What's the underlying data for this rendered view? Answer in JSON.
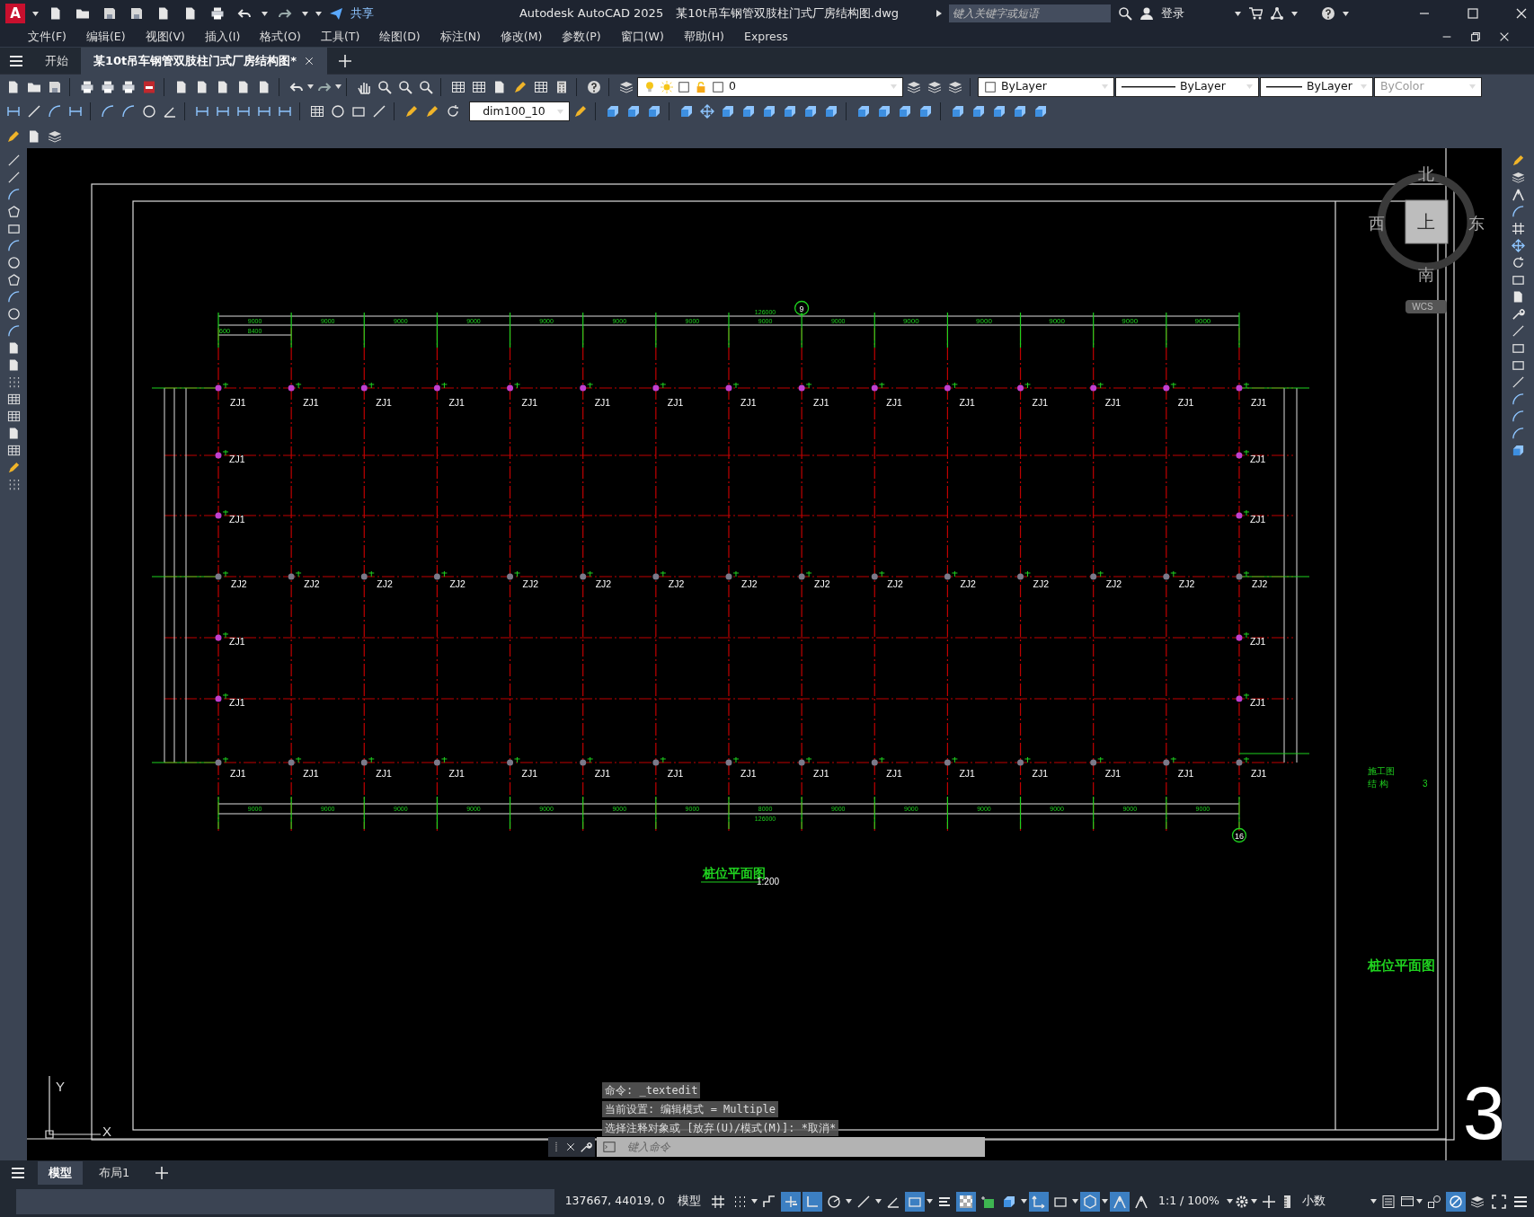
{
  "title_bar": {
    "logo": "A",
    "share": "共享",
    "app_title": "Autodesk AutoCAD 2025",
    "file_title": "某10t吊车钢管双肢柱门式厂房结构图.dwg",
    "search": {
      "placeholder": "键入关键字或短语"
    },
    "login": "登录"
  },
  "menu": [
    "文件(F)",
    "编辑(E)",
    "视图(V)",
    "插入(I)",
    "格式(O)",
    "工具(T)",
    "绘图(D)",
    "标注(N)",
    "修改(M)",
    "参数(P)",
    "窗口(W)",
    "帮助(H)",
    "Express"
  ],
  "doc_tabs": [
    {
      "label": "开始",
      "selected": false
    },
    {
      "label": "某10t吊车钢管双肢柱门式厂房结构图*",
      "selected": true
    }
  ],
  "properties": {
    "layer": "0",
    "colour_control": "ByLayer",
    "linetype": "ByLayer",
    "lineweight": "ByLayer",
    "plot_style": {
      "value": "ByColor",
      "disabled": true
    },
    "dim_style": "dim100_10"
  },
  "viewcube": {
    "north": "北",
    "south": "南",
    "west": "西",
    "east": "东",
    "face": "上",
    "wcs": "WCS"
  },
  "drawing": {
    "top_axis": "9",
    "bottom_axis": "16",
    "top_total": "126000",
    "top_sub": [
      "600",
      "8400"
    ],
    "top_spans": [
      "9000",
      "9000",
      "9000",
      "9000",
      "9000",
      "9000",
      "9000",
      "9000",
      "9000",
      "9000",
      "9000",
      "9000",
      "9000",
      "9000"
    ],
    "bottom_spans": [
      "9000",
      "9000",
      "9000",
      "9000",
      "9000",
      "9000",
      "9000",
      "8000",
      "9000",
      "9000",
      "9000",
      "9000",
      "9000",
      "9000"
    ],
    "bottom_total": "126000",
    "rows": [
      {
        "kind": "full",
        "color": "#c040d0",
        "labels": [
          "ZJ1",
          "ZJ1",
          "ZJ1",
          "ZJ1",
          "ZJ1",
          "ZJ1",
          "ZJ1",
          "ZJ1",
          "ZJ1",
          "ZJ1",
          "ZJ1",
          "ZJ1",
          "ZJ1",
          "ZJ1",
          "ZJ1"
        ]
      },
      {
        "kind": "ends",
        "color": "#c040d0",
        "labels": [
          "ZJ1",
          "ZJ1"
        ]
      },
      {
        "kind": "ends",
        "color": "#c040d0",
        "labels": [
          "ZJ1",
          "ZJ1"
        ]
      },
      {
        "kind": "full",
        "color": "#7a7a8a",
        "labels": [
          "ZJ2",
          "ZJ2",
          "ZJ2",
          "ZJ2",
          "ZJ2",
          "ZJ2",
          "ZJ2",
          "ZJ2",
          "ZJ2",
          "ZJ2",
          "ZJ2",
          "ZJ2",
          "ZJ2",
          "ZJ2",
          "ZJ2"
        ]
      },
      {
        "kind": "ends",
        "color": "#c040d0",
        "labels": [
          "ZJ1",
          "ZJ1"
        ]
      },
      {
        "kind": "ends",
        "color": "#c040d0",
        "labels": [
          "ZJ1",
          "ZJ1"
        ]
      },
      {
        "kind": "full",
        "color": "#7a7a8a",
        "labels": [
          "ZJ1",
          "ZJ1",
          "ZJ1",
          "ZJ1",
          "ZJ1",
          "ZJ1",
          "ZJ1",
          "ZJ1",
          "ZJ1",
          "ZJ1",
          "ZJ1",
          "ZJ1",
          "ZJ1",
          "ZJ1",
          "ZJ1"
        ]
      }
    ],
    "title": "桩位平面图",
    "scale": "1:200"
  },
  "title_block": {
    "stage": "施工图",
    "discipline": "结 构",
    "number": "3",
    "drawing_name": "桩位平面图",
    "sheet": "3"
  },
  "ucs": {
    "y": "Y",
    "x": "X"
  },
  "command_history": [
    "命令: _textedit",
    "当前设置: 编辑模式 = Multiple",
    "选择注释对象或 [放弃(U)/模式(M)]: *取消*"
  ],
  "command": {
    "placeholder": "键入命令"
  },
  "layout_tabs": [
    {
      "label": "模型",
      "selected": true
    },
    {
      "label": "布局1",
      "selected": false
    }
  ],
  "status_bar": {
    "coords": "137667, 44019, 0",
    "space": "模型",
    "annotation_scale": "1:1 / 100%",
    "units": "小数",
    "toggles": [
      {
        "kind": "grid",
        "on": false
      },
      {
        "kind": "dots",
        "on": false
      },
      {
        "kind": "snap",
        "on": false
      },
      {
        "kind": "infer",
        "on": true
      },
      {
        "kind": "ortho",
        "on": true
      },
      {
        "kind": "polar",
        "on": false
      },
      {
        "kind": "iso",
        "on": false
      },
      {
        "kind": "angle",
        "on": false
      },
      {
        "kind": "osnap",
        "on": true
      },
      {
        "kind": "lineweight",
        "on": false
      },
      {
        "kind": "transparency",
        "on": true
      },
      {
        "kind": "select",
        "on": false
      },
      {
        "kind": "gizmo",
        "on": false
      },
      {
        "kind": "ucsdyn",
        "on": true
      },
      {
        "kind": "selcycle",
        "on": false
      },
      {
        "kind": "cube",
        "on": true
      },
      {
        "kind": "annovis",
        "on": true
      },
      {
        "kind": "annoauto",
        "on": false
      }
    ]
  }
}
